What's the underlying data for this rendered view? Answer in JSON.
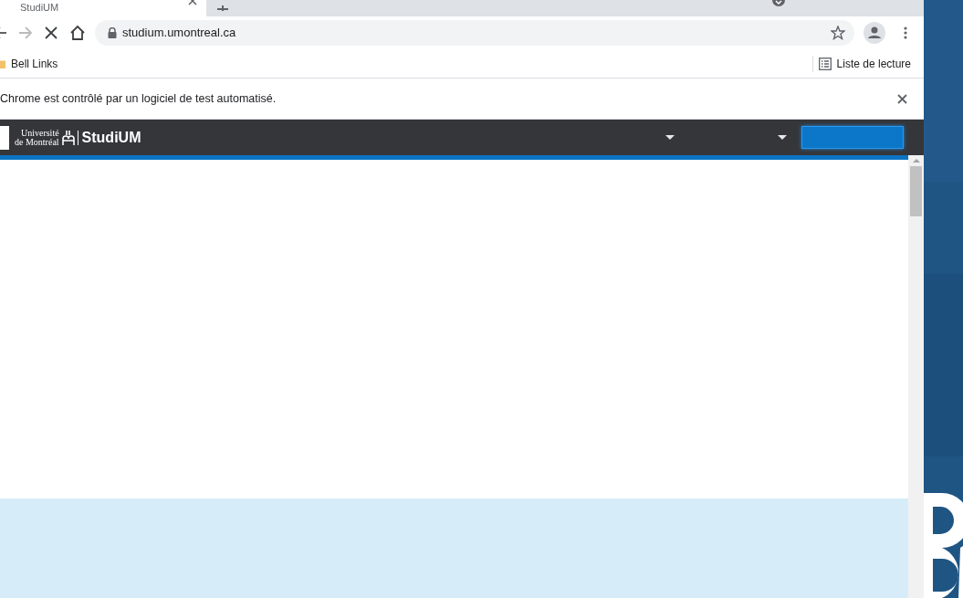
{
  "tab": {
    "title": "StudiUM"
  },
  "toolbar": {
    "address": "studium.umontreal.ca",
    "loading": true
  },
  "bookmarks": [
    {
      "label": "Bell Links"
    }
  ],
  "reading_list": {
    "label": "Liste de lecture"
  },
  "infobar": {
    "message": "Chrome est contrôlé par un logiciel de test automatisé."
  },
  "site": {
    "logo_line_1": "Université",
    "logo_line_2": "de Montréal",
    "brand": "StudiUM"
  }
}
